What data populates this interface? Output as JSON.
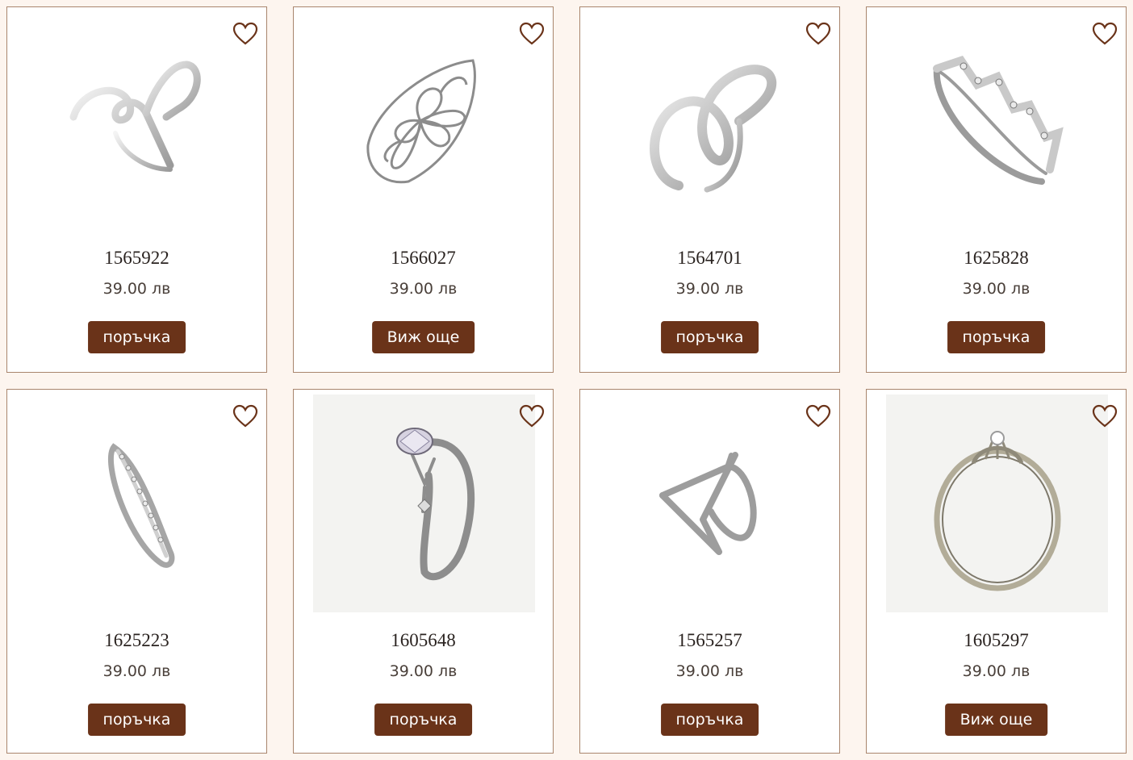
{
  "colors": {
    "page_background": "#fdf5ef",
    "button_background": "#6a3319",
    "card_border": "#a9856d",
    "heart_stroke": "#6a3319"
  },
  "products": [
    {
      "sku": "1565922",
      "price": "39.00 лв",
      "button_label": "поръчка",
      "icon": "heart-outline-icon",
      "image": "silver-ring-swirl"
    },
    {
      "sku": "1566027",
      "price": "39.00 лв",
      "button_label": "Виж още",
      "icon": "heart-outline-icon",
      "image": "silver-ring-filigree-flower"
    },
    {
      "sku": "1564701",
      "price": "39.00 лв",
      "button_label": "поръчка",
      "icon": "heart-outline-icon",
      "image": "silver-ring-infinity"
    },
    {
      "sku": "1625828",
      "price": "39.00 лв",
      "button_label": "поръчка",
      "icon": "heart-outline-icon",
      "image": "silver-ring-zigzag-stones"
    },
    {
      "sku": "1625223",
      "price": "39.00 лв",
      "button_label": "поръчка",
      "icon": "heart-outline-icon",
      "image": "silver-ring-eternity-band"
    },
    {
      "sku": "1605648",
      "price": "39.00 лв",
      "button_label": "поръчка",
      "icon": "heart-outline-icon",
      "image": "silver-ring-pear-stone"
    },
    {
      "sku": "1565257",
      "price": "39.00 лв",
      "button_label": "поръчка",
      "icon": "heart-outline-icon",
      "image": "silver-ring-crossover"
    },
    {
      "sku": "1605297",
      "price": "39.00 лв",
      "button_label": "Виж още",
      "icon": "heart-outline-icon",
      "image": "silver-ring-solitaire"
    }
  ]
}
